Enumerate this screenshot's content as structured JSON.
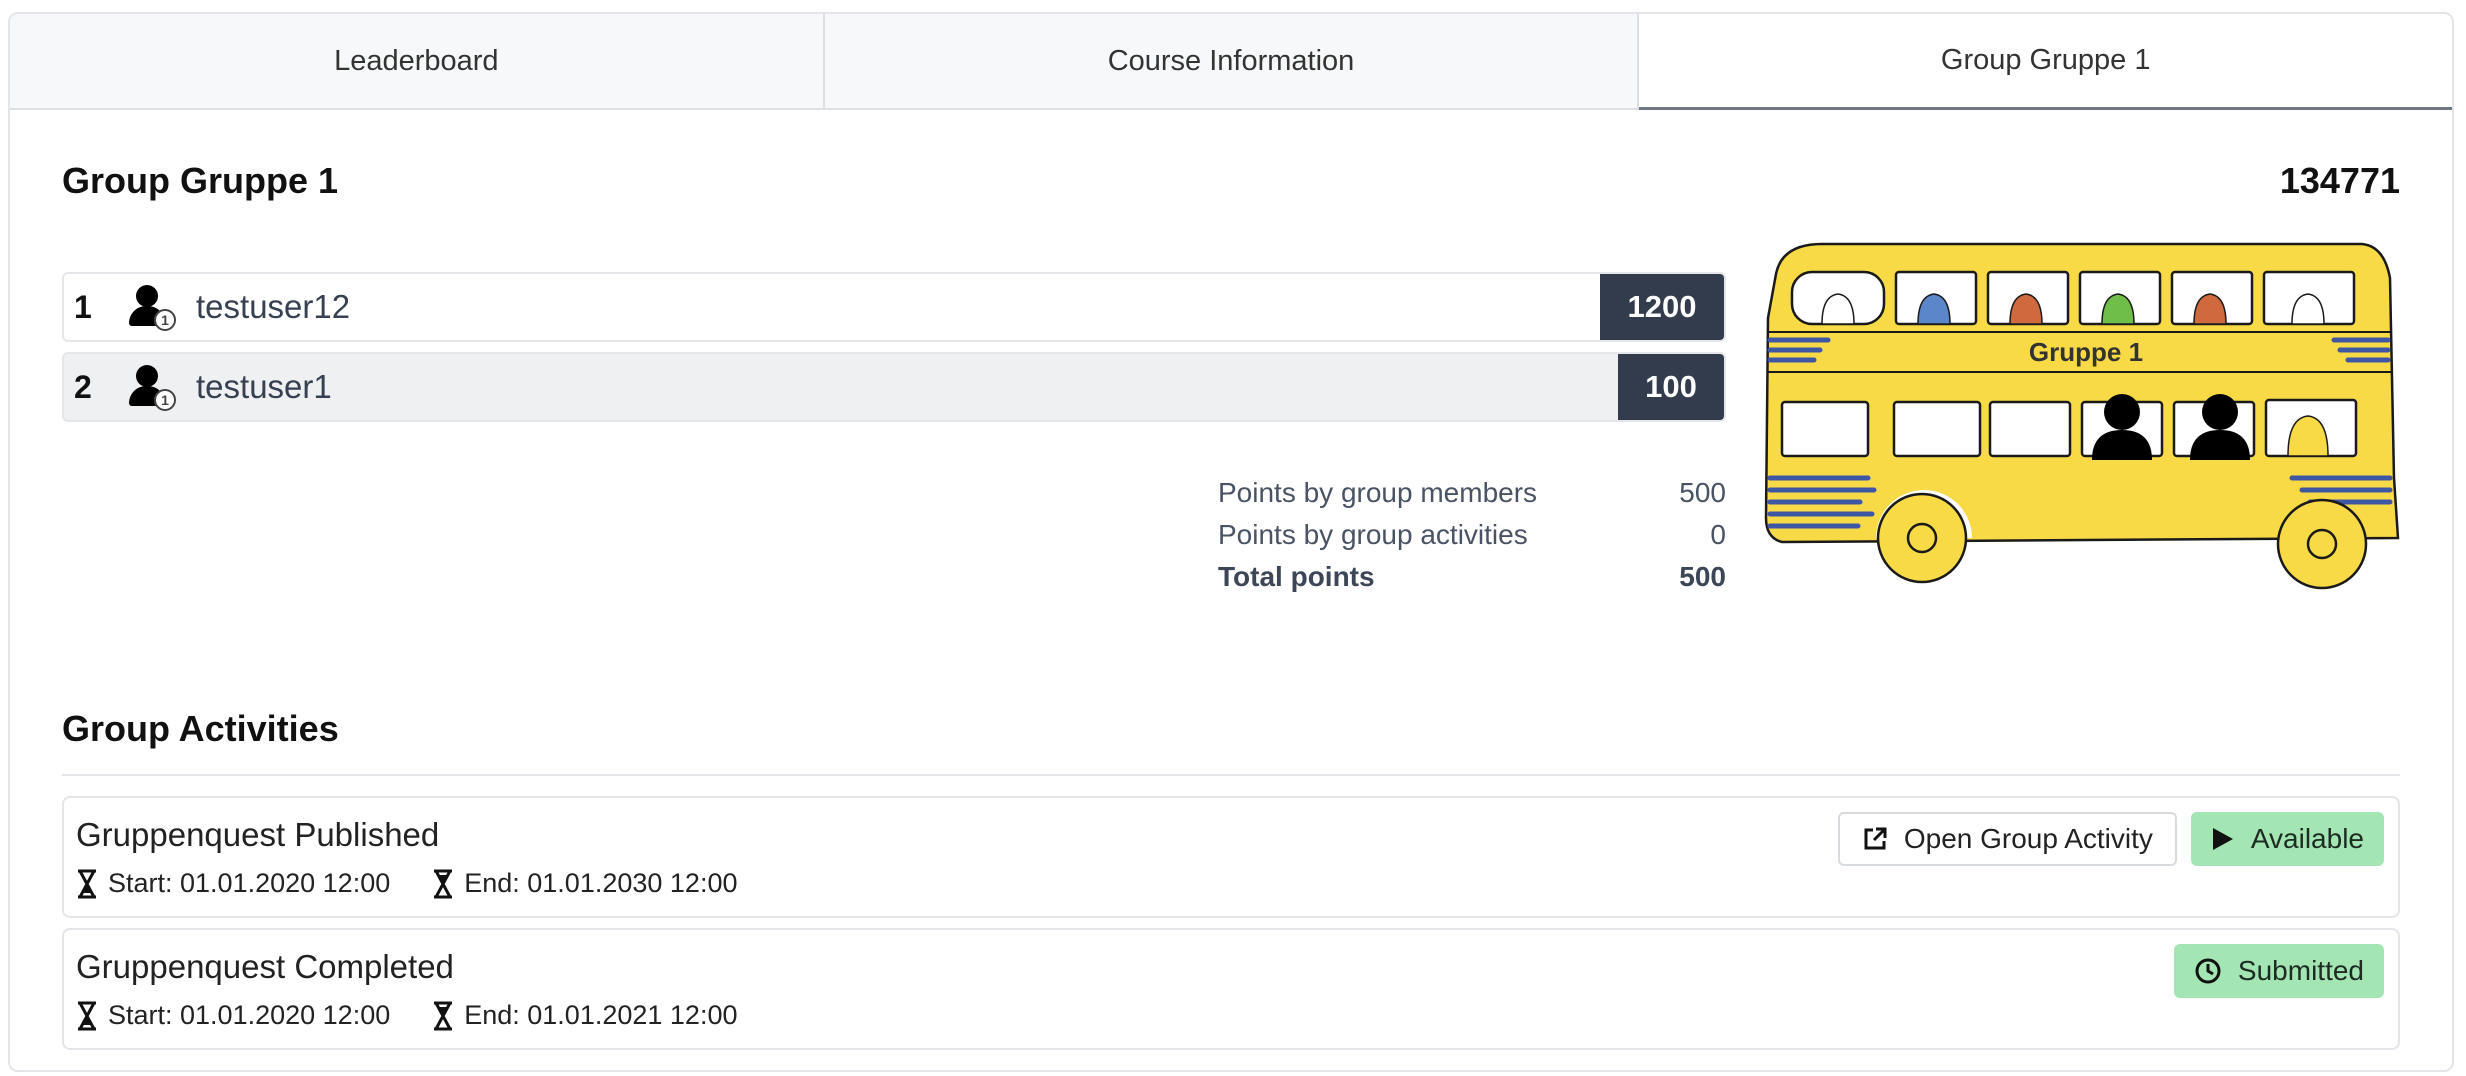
{
  "tabs": [
    {
      "label": "Leaderboard"
    },
    {
      "label": "Course Information"
    },
    {
      "label": "Group Gruppe 1"
    }
  ],
  "group": {
    "title": "Group Gruppe 1",
    "code": "134771",
    "bus_label": "Gruppe 1"
  },
  "members": [
    {
      "rank": "1",
      "name": "testuser12",
      "badge": "1",
      "score": "1200"
    },
    {
      "rank": "2",
      "name": "testuser1",
      "badge": "1",
      "score": "100"
    }
  ],
  "points": {
    "members_label": "Points by group members",
    "members_value": "500",
    "activities_label": "Points by group activities",
    "activities_value": "0",
    "total_label": "Total points",
    "total_value": "500"
  },
  "activities_section": {
    "title": "Group Activities",
    "items": [
      {
        "name": "Gruppenquest Published",
        "start": "Start: 01.01.2020 12:00",
        "end": "End: 01.01.2030 12:00",
        "open_label": "Open Group Activity",
        "status": "Available"
      },
      {
        "name": "Gruppenquest Completed",
        "start": "Start: 01.01.2020 12:00",
        "end": "End: 01.01.2021 12:00",
        "status": "Submitted"
      }
    ]
  },
  "colors": {
    "score_bg": "#333c4c",
    "status_bg": "#a3e6b3",
    "bus_yellow": "#f7da45",
    "bus_stripes": "#3f56a5"
  },
  "icons": {
    "user": "user-icon",
    "hourglass": "hourglass-icon",
    "open": "external-link-icon",
    "available": "play-icon",
    "submitted": "clock-icon"
  }
}
